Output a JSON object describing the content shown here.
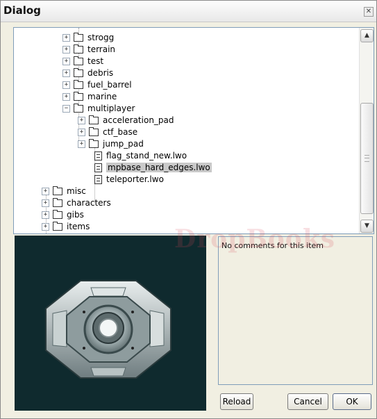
{
  "window": {
    "title": "Dialog",
    "close_glyph": "✕"
  },
  "tree": {
    "nodes": [
      {
        "label": "strogg",
        "type": "folder",
        "expander": "+"
      },
      {
        "label": "terrain",
        "type": "folder",
        "expander": "+"
      },
      {
        "label": "test",
        "type": "folder",
        "expander": "+"
      },
      {
        "label": "debris",
        "type": "folder",
        "expander": "+"
      },
      {
        "label": "fuel_barrel",
        "type": "folder",
        "expander": "+"
      },
      {
        "label": "marine",
        "type": "folder",
        "expander": "+"
      },
      {
        "label": "multiplayer",
        "type": "folder",
        "expander": "−"
      },
      {
        "label": "acceleration_pad",
        "type": "folder",
        "expander": "+"
      },
      {
        "label": "ctf_base",
        "type": "folder",
        "expander": "+"
      },
      {
        "label": "jump_pad",
        "type": "folder",
        "expander": "+"
      },
      {
        "label": "flag_stand_new.lwo",
        "type": "file",
        "expander": ""
      },
      {
        "label": "mpbase_hard_edges.lwo",
        "type": "file",
        "expander": "",
        "selected": true
      },
      {
        "label": "teleporter.lwo",
        "type": "file",
        "expander": ""
      },
      {
        "label": "misc",
        "type": "folder",
        "expander": "+"
      },
      {
        "label": "characters",
        "type": "folder",
        "expander": "+"
      },
      {
        "label": "gibs",
        "type": "folder",
        "expander": "+"
      },
      {
        "label": "items",
        "type": "folder",
        "expander": "+"
      }
    ],
    "scroll_up_glyph": "▲",
    "scroll_down_glyph": "▼"
  },
  "comments": {
    "text": "No comments for this item"
  },
  "buttons": {
    "reload": "Reload",
    "cancel": "Cancel",
    "ok": "OK"
  },
  "watermark": {
    "text": "DropBooks"
  }
}
